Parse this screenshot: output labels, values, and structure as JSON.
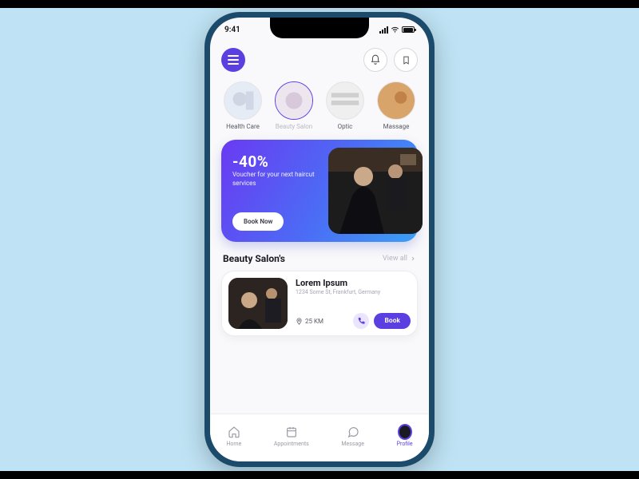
{
  "status": {
    "time": "9:41"
  },
  "categories": [
    {
      "label": "Health Care"
    },
    {
      "label": "Beauty Salon"
    },
    {
      "label": "Optic"
    },
    {
      "label": "Massage"
    }
  ],
  "promo": {
    "discount": "-40%",
    "caption": "Voucher for your next haircut services",
    "cta": "Book Now"
  },
  "section": {
    "title": "Beauty Salon's",
    "viewall": "View all"
  },
  "salon": {
    "name": "Lorem Ipsum",
    "address": "1234 Some St, Frankfurt, Germany",
    "distance": "25 KM",
    "book": "Book"
  },
  "nav": {
    "home": "Home",
    "appointments": "Appointments",
    "message": "Message",
    "profile": "Profile"
  }
}
